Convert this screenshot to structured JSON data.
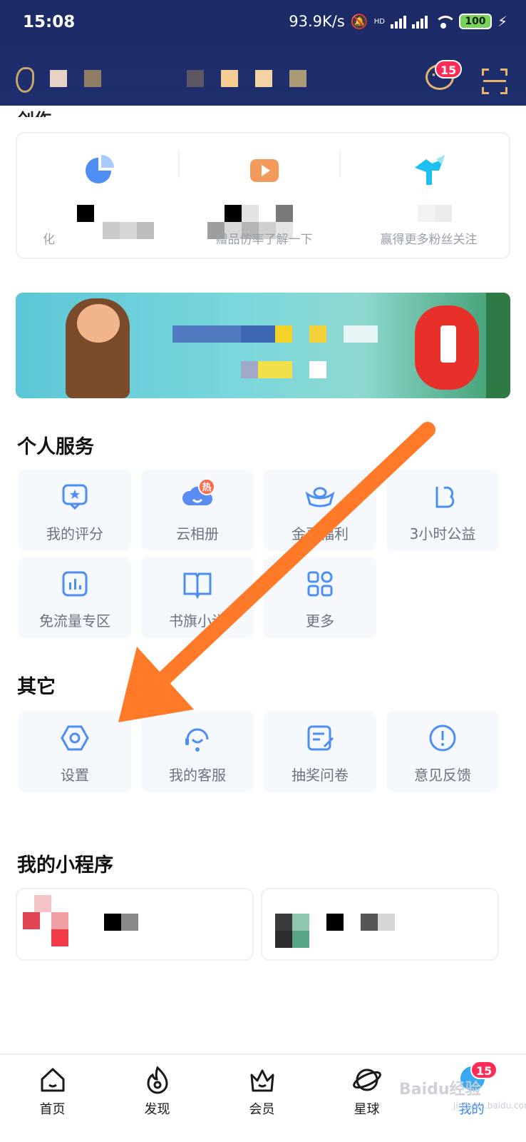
{
  "status_bar": {
    "time": "15:08",
    "network_speed": "93.9K/s",
    "hd_label": "HD",
    "battery": "100"
  },
  "header": {
    "message_badge": "15",
    "icons": [
      "chat-bubble-icon",
      "scan-icon"
    ]
  },
  "creator_section": {
    "title_partial": "创作",
    "items": [
      {
        "icon": "pie-chart-icon",
        "subtitle": "化"
      },
      {
        "icon": "video-icon",
        "subtitle": "赠品仿率了解一下"
      },
      {
        "icon": "bird-icon",
        "subtitle": "赢得更多粉丝关注"
      }
    ]
  },
  "services": {
    "title": "个人服务",
    "items": [
      {
        "label": "我的评分",
        "icon": "rating-icon"
      },
      {
        "label": "云相册",
        "icon": "cloud-album-icon",
        "badge": "热"
      },
      {
        "label": "金豆福利",
        "icon": "gold-ingot-icon"
      },
      {
        "label": "3小时公益",
        "icon": "charity-icon"
      },
      {
        "label": "免流量专区",
        "icon": "data-free-icon"
      },
      {
        "label": "书旗小说",
        "icon": "book-icon"
      },
      {
        "label": "更多",
        "icon": "more-grid-icon"
      }
    ]
  },
  "other": {
    "title": "其它",
    "items": [
      {
        "label": "设置",
        "icon": "settings-icon"
      },
      {
        "label": "我的客服",
        "icon": "customer-service-icon"
      },
      {
        "label": "抽奖问卷",
        "icon": "survey-icon"
      },
      {
        "label": "意见反馈",
        "icon": "feedback-icon"
      }
    ]
  },
  "mini_programs": {
    "title": "我的小程序"
  },
  "bottom_nav": {
    "items": [
      {
        "label": "首页",
        "icon": "home-icon"
      },
      {
        "label": "发现",
        "icon": "flame-icon"
      },
      {
        "label": "会员",
        "icon": "crown-icon"
      },
      {
        "label": "星球",
        "icon": "planet-icon"
      },
      {
        "label": "我的",
        "icon": "profile-icon",
        "badge": "15"
      }
    ]
  },
  "watermark": {
    "text": "Baidu经验",
    "sub": "jingyan.baidu.com"
  },
  "colors": {
    "header_bg": "#1f2f6e",
    "accent_blue": "#2f8bf0",
    "icon_blue": "#4d8ef5",
    "arrow_orange": "#ff7a28",
    "badge_red": "#ff2b57"
  }
}
